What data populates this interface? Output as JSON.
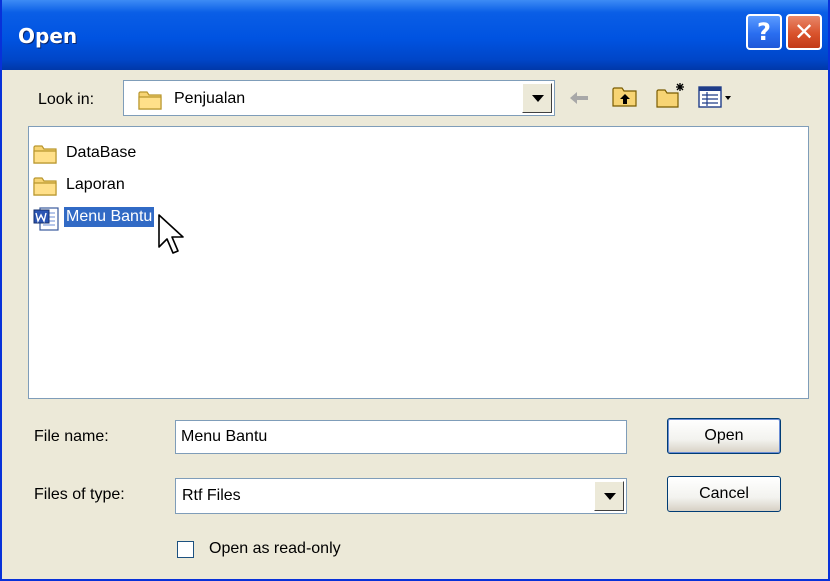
{
  "window": {
    "title": "Open",
    "help_glyph": "?",
    "close_glyph": "✕"
  },
  "toolbar": {
    "look_in_label": "Look in:",
    "look_in_value": "Penjualan",
    "icons": [
      "folder-icon",
      "back-icon",
      "up-one-level-icon",
      "new-folder-icon",
      "views-icon"
    ]
  },
  "files": [
    {
      "name": "DataBase",
      "icon": "folder-icon",
      "selected": false
    },
    {
      "name": "Laporan",
      "icon": "folder-icon",
      "selected": false
    },
    {
      "name": "Menu Bantu",
      "icon": "word-document-icon",
      "selected": true
    }
  ],
  "form": {
    "file_name_label": "File name:",
    "file_name_value": "Menu Bantu",
    "file_type_label": "Files of type:",
    "file_type_value": "Rtf Files",
    "read_only_label": "Open as read-only",
    "read_only_checked": false
  },
  "buttons": {
    "open": "Open",
    "cancel": "Cancel"
  },
  "colors": {
    "title_bar": "#0053e1",
    "selection": "#316ac5",
    "face": "#ece9d8"
  }
}
